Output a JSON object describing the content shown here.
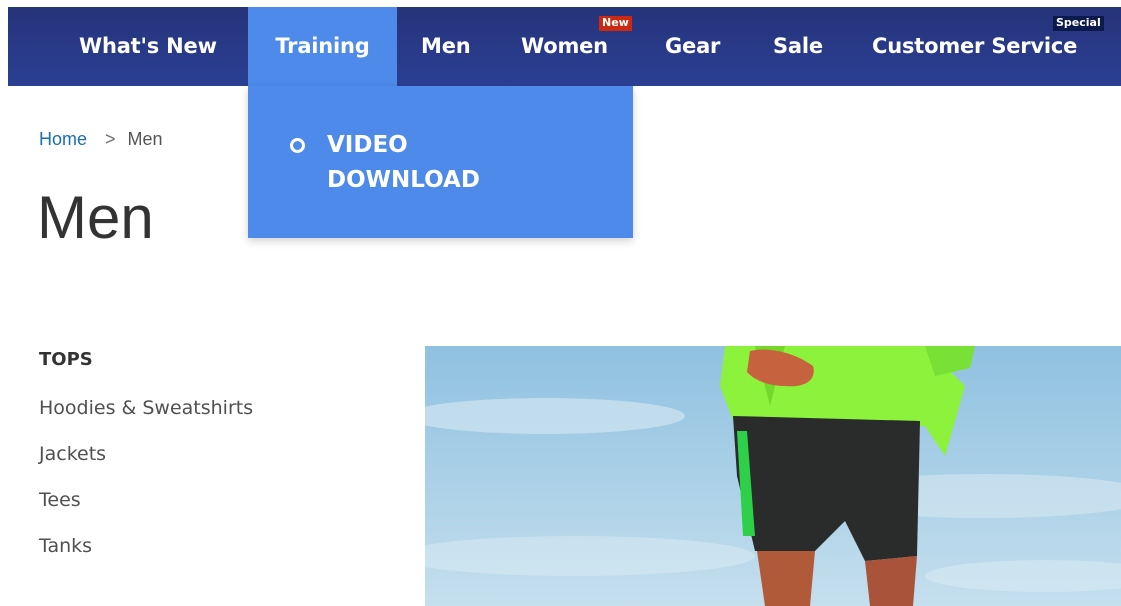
{
  "nav": {
    "items": [
      {
        "label": "What's New"
      },
      {
        "label": "Training"
      },
      {
        "label": "Men"
      },
      {
        "label": "Women"
      },
      {
        "label": "Gear"
      },
      {
        "label": "Sale"
      },
      {
        "label": "Customer Service"
      }
    ],
    "active_item": "Training",
    "badges": {
      "women": "New",
      "customer_service": "Special"
    }
  },
  "dropdown": {
    "items": [
      {
        "label": "VIDEO DOWNLOAD"
      }
    ]
  },
  "breadcrumb": {
    "home": "Home",
    "separator": ">",
    "current": "Men"
  },
  "page": {
    "title": "Men"
  },
  "sidebar": {
    "heading": "TOPS",
    "links": [
      {
        "label": "Hoodies & Sweatshirts"
      },
      {
        "label": "Jackets"
      },
      {
        "label": "Tees"
      },
      {
        "label": "Tanks"
      }
    ]
  },
  "colors": {
    "nav_background": "#2b3f93",
    "nav_active": "#4d8ae9",
    "badge_new": "#cc2a10",
    "badge_special": "#0b1a4a",
    "link": "#1a6fb3"
  },
  "hero": {
    "icon": "runner-photo"
  }
}
